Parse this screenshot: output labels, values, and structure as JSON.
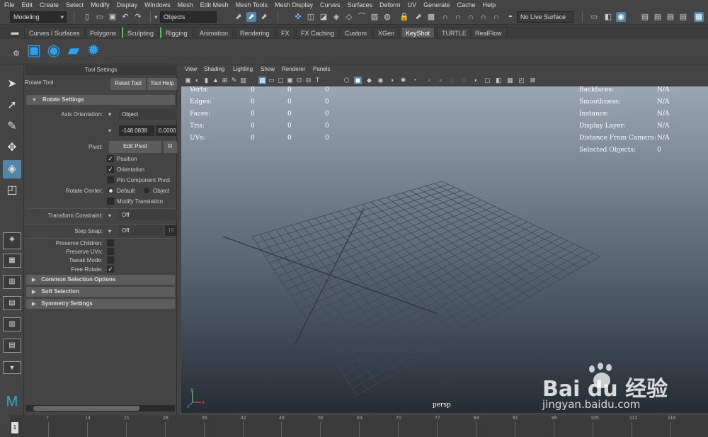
{
  "menu": [
    "File",
    "Edit",
    "Create",
    "Select",
    "Modify",
    "Display",
    "Windows",
    "Mesh",
    "Edit Mesh",
    "Mesh Tools",
    "Mesh Display",
    "Curves",
    "Surfaces",
    "Deform",
    "UV",
    "Generate",
    "Cache",
    "Help"
  ],
  "status": {
    "mode": "Modeling",
    "select_mode": "Objects",
    "live_surface": "No Live Surface"
  },
  "shelf_tabs": [
    "Curves / Surfaces",
    "Polygons",
    "Sculpting",
    "Rigging",
    "Animation",
    "Rendering",
    "FX",
    "FX Caching",
    "Custom",
    "XGen",
    "KeyShot",
    "TURTLE",
    "RealFlow"
  ],
  "tool_settings": {
    "panel_title": "Tool Settings",
    "tool_name": "Rotate Tool",
    "reset_tool": "Reset Tool",
    "tool_help": "Tool Help",
    "rotate_settings": "Rotate Settings",
    "axis_orientation_label": "Axis Orientation:",
    "axis_orientation_value": "Object",
    "axis_value_1": "-148.0838",
    "axis_value_2": "0.0000",
    "pivot_label": "Pivot:",
    "edit_pivot": "Edit Pivot",
    "reset_short": "R",
    "position": "Position",
    "orientation": "Orientation",
    "pin_component_pivot": "Pin Component Pivot",
    "rotate_center_label": "Rotate Center:",
    "default": "Default",
    "object": "Object",
    "modify_translation": "Modify Translation",
    "transform_constraint_label": "Transform Constraint:",
    "transform_constraint_value": "Off",
    "step_snap_label": "Step Snap:",
    "step_snap_value": "Off",
    "step_snap_number": "15",
    "preserve_children": "Preserve Children:",
    "preserve_uvs": "Preserve UVs:",
    "tweak_mode": "Tweak Mode:",
    "free_rotate": "Free Rotate:",
    "common_selection": "Common Selection Options",
    "soft_selection": "Soft Selection",
    "symmetry_settings": "Symmetry Settings"
  },
  "viewport": {
    "menus": [
      "View",
      "Shading",
      "Lighting",
      "Show",
      "Renderer",
      "Panels"
    ],
    "camera": "persp",
    "hud_left": [
      {
        "label": "Verts:",
        "a": "0",
        "b": "0",
        "c": "0"
      },
      {
        "label": "Edges:",
        "a": "0",
        "b": "0",
        "c": "0"
      },
      {
        "label": "Faces:",
        "a": "0",
        "b": "0",
        "c": "0"
      },
      {
        "label": "Tris:",
        "a": "0",
        "b": "0",
        "c": "0"
      },
      {
        "label": "UVs:",
        "a": "0",
        "b": "0",
        "c": "0"
      }
    ],
    "hud_right": [
      {
        "label": "Backfaces:",
        "value": "N/A"
      },
      {
        "label": "Smoothness:",
        "value": "N/A"
      },
      {
        "label": "Instance:",
        "value": "N/A"
      },
      {
        "label": "Display Layer:",
        "value": "N/A"
      },
      {
        "label": "Distance From Camera:",
        "value": "N/A"
      },
      {
        "label": "Selected Objects:",
        "value": "0"
      }
    ]
  },
  "timeline": {
    "current": "1",
    "ticks": [
      "7",
      "14",
      "21",
      "28",
      "35",
      "42",
      "49",
      "56",
      "63",
      "70",
      "77",
      "84",
      "91",
      "98",
      "105",
      "112",
      "119"
    ]
  },
  "watermark": {
    "brand": "Bai du 经验",
    "url": "jingyan.baidu.com"
  },
  "colors": {
    "accent": "#5285a6",
    "shelf_icon": "#2aa0ef",
    "marked_tab": "#3fd04b"
  }
}
